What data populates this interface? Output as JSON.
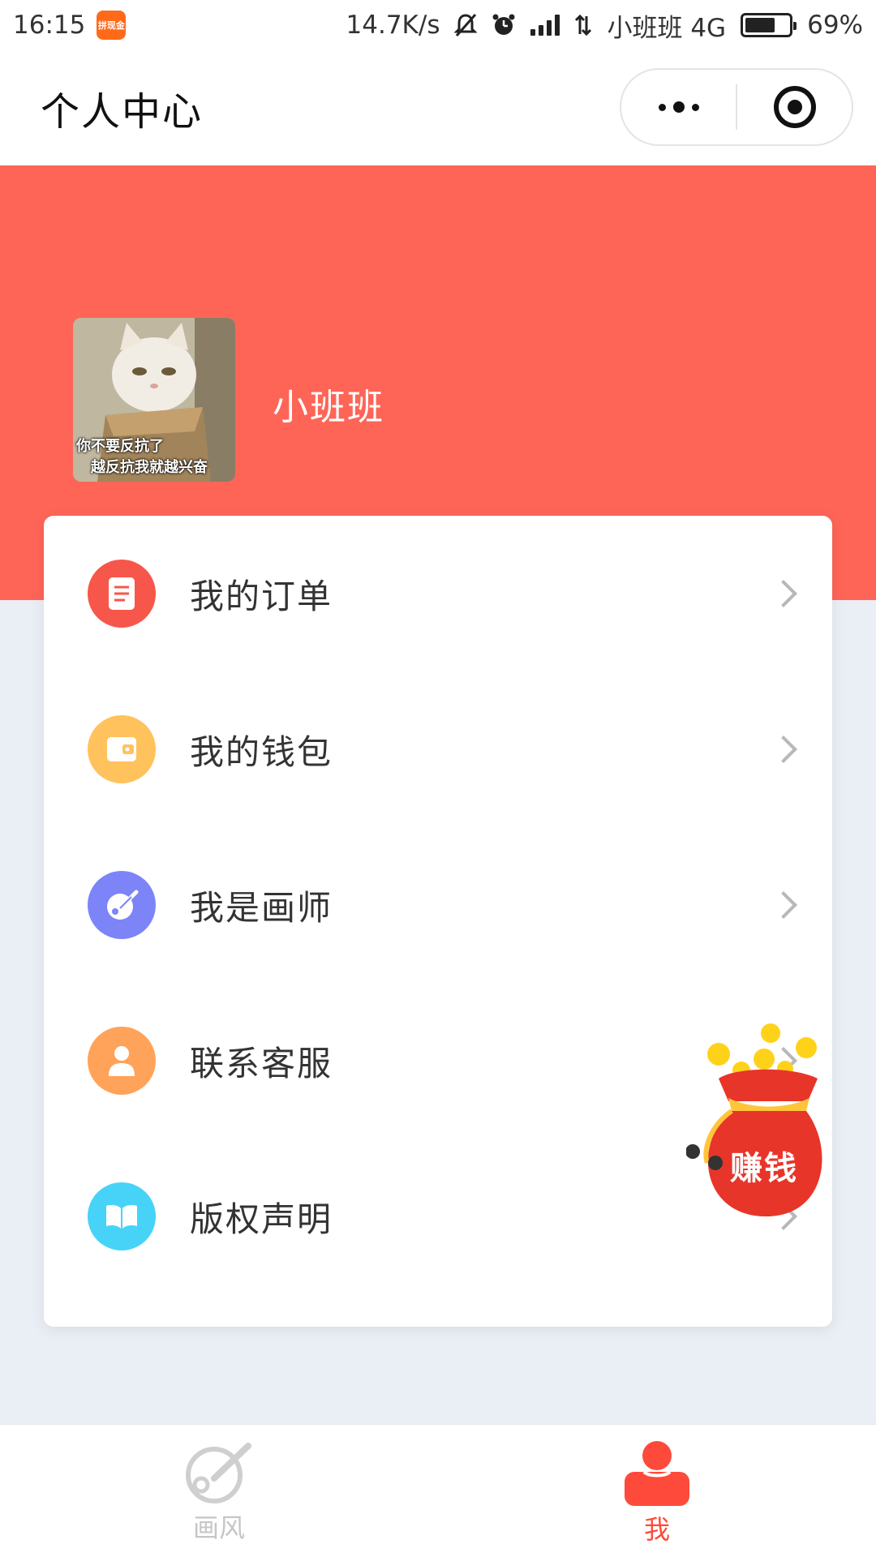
{
  "status_bar": {
    "time": "16:15",
    "app_badge": "拼现金",
    "net_speed": "14.7K/s",
    "carrier": "小班班 4G",
    "battery_percent": "69%",
    "battery_level": 0.69,
    "icons": [
      "bell-mute-icon",
      "alarm-icon",
      "signal-icon",
      "data-arrows-icon",
      "battery-icon"
    ]
  },
  "nav": {
    "title": "个人中心",
    "capsule_icons": [
      "more-dots-icon",
      "close-target-icon"
    ]
  },
  "profile": {
    "avatar_caption_line1": "你不要反抗了",
    "avatar_caption_line2": "越反抗我就越兴奋",
    "username": "小班班"
  },
  "menu": {
    "items": [
      {
        "label": "我的订单",
        "icon": "order-icon",
        "color": "#f7564a"
      },
      {
        "label": "我的钱包",
        "icon": "wallet-icon",
        "color": "#ffc25c"
      },
      {
        "label": "我是画师",
        "icon": "painter-icon",
        "color": "#7c84f8"
      },
      {
        "label": "联系客服",
        "icon": "service-icon",
        "color": "#ffa35a"
      },
      {
        "label": "版权声明",
        "icon": "book-icon",
        "color": "#47d3f7"
      }
    ]
  },
  "float_widget": {
    "label": "赚钱",
    "icon": "money-bag-icon"
  },
  "tab_bar": {
    "tabs": [
      {
        "label": "画风",
        "icon": "paint-icon",
        "active": false
      },
      {
        "label": "我",
        "icon": "user-icon",
        "active": true
      }
    ]
  },
  "colors": {
    "primary": "#fe6557",
    "active_tab": "#fe4a3b",
    "background": "#eaeef5"
  }
}
